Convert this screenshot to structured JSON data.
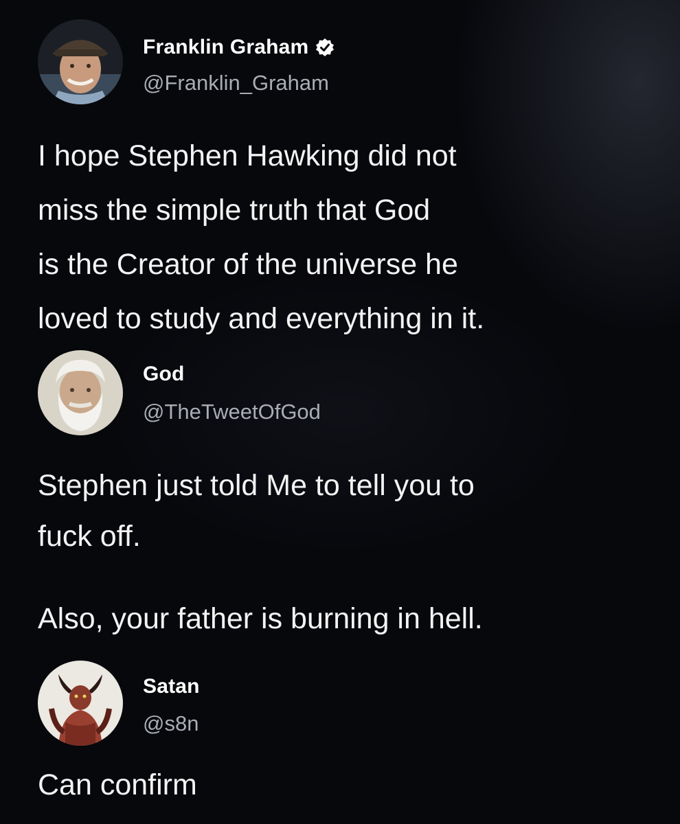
{
  "tweets": [
    {
      "name": "Franklin Graham",
      "handle": "@Franklin_Graham",
      "verified": true,
      "text": "I hope Stephen Hawking did not\nmiss the simple truth that God\nis the Creator of the universe he\nloved to study and everything in it."
    },
    {
      "name": "God",
      "handle": "@TheTweetOfGod",
      "verified": false,
      "text": "Stephen just told Me to tell you to\nfuck off.",
      "text2": "Also, your father is burning in hell."
    },
    {
      "name": "Satan",
      "handle": "@s8n",
      "verified": false,
      "text": "Can confirm"
    }
  ],
  "icons": {
    "verified": "verified-badge-icon"
  },
  "colors": {
    "background": "#07080c",
    "name": "#ffffff",
    "handle": "#a9adb4",
    "text": "#f3f3f3"
  }
}
